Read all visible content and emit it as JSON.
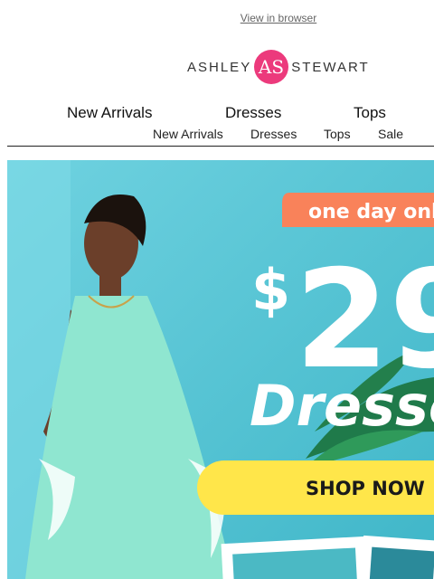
{
  "header": {
    "view_in_browser": "View in browser",
    "logo": {
      "left": "ASHLEY",
      "right": "STEWART",
      "mark": "AS"
    }
  },
  "nav_primary": [
    "New Arrivals",
    "Dresses",
    "Tops"
  ],
  "nav_secondary": [
    "New Arrivals",
    "Dresses",
    "Tops",
    "Sale"
  ],
  "hero": {
    "promo_tag": "one day onl",
    "price_symbol": "$",
    "price": "29",
    "headline": "Dresse",
    "cta": "SHOP NOW"
  },
  "colors": {
    "brand": "#ec3a7c",
    "promo_tag": "#f9825a",
    "cta": "#ffe64a",
    "hero_bg": "#5cc7d6",
    "dress": "#8fe6d0"
  }
}
